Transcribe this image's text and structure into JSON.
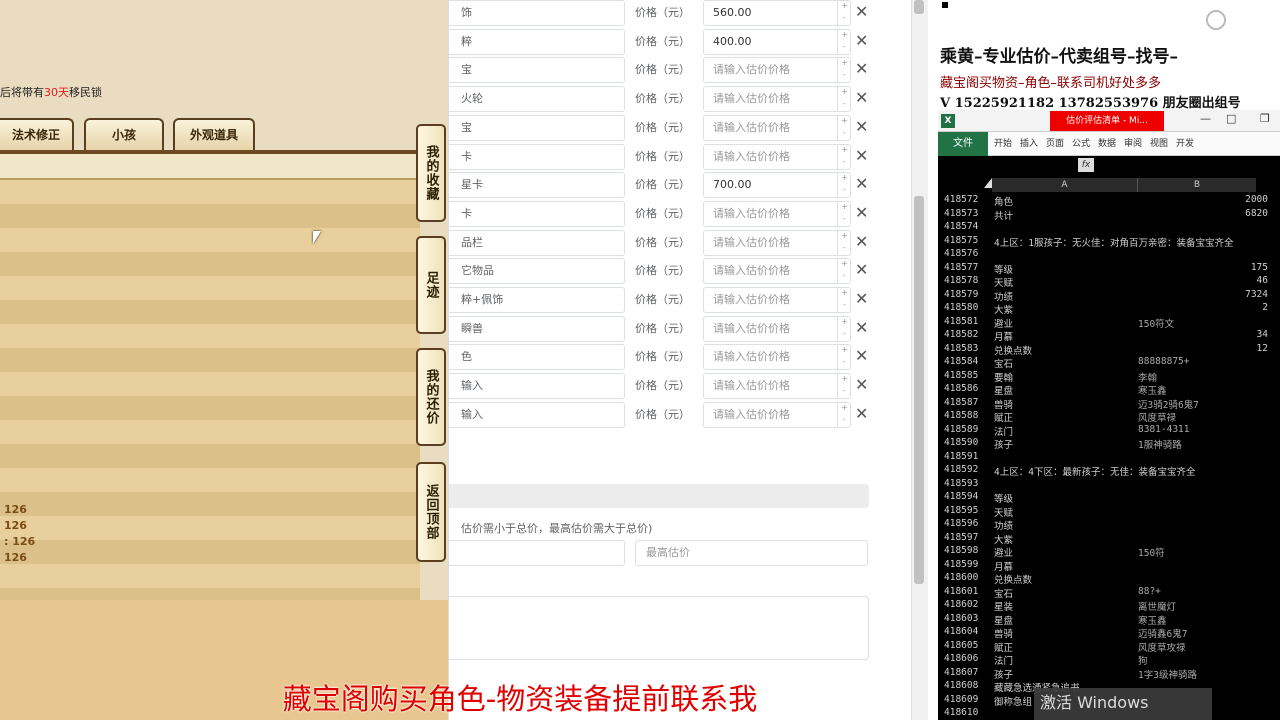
{
  "game": {
    "notice_prefix": "后将带有",
    "notice_days": "30天",
    "notice_suffix": "移民锁",
    "tabs": [
      "法术修正",
      "小孩",
      "外观道具"
    ],
    "side_buttons": [
      "我的收藏",
      "足迹",
      "我的还价",
      "返回顶部"
    ],
    "values": [
      "126",
      "126",
      ": 126",
      "126"
    ]
  },
  "form": {
    "price_label": "价格（元）",
    "price_placeholder": "请输入估价价格",
    "rows": [
      {
        "name": "饰",
        "price": "560.00"
      },
      {
        "name": "粹",
        "price": "400.00"
      },
      {
        "name": "宝",
        "price": ""
      },
      {
        "name": "火轮",
        "price": ""
      },
      {
        "name": "宝",
        "price": ""
      },
      {
        "name": "卡",
        "price": ""
      },
      {
        "name": "星卡",
        "price": "700.00"
      },
      {
        "name": "卡",
        "price": ""
      },
      {
        "name": "品栏",
        "price": ""
      },
      {
        "name": "它物品",
        "price": ""
      },
      {
        "name": "粹+佩饰",
        "price": ""
      },
      {
        "name": "瞬兽",
        "price": ""
      },
      {
        "name": "色",
        "price": ""
      },
      {
        "name": "输入",
        "price": ""
      },
      {
        "name": "输入",
        "price": ""
      }
    ],
    "hint": "估价需小于总价，最高估价需大于总价)",
    "max_placeholder": "最高估价"
  },
  "right": {
    "line1": "乘黄–专业估价–代卖组号–找号–",
    "line2": "藏宝阁买物资–角色–联系司机好处多多",
    "line3": "V 15225921182   13782553976 朋友圈出组号"
  },
  "excel": {
    "title": "估价评估清单 - Mi...",
    "file_tab": "文件",
    "ribbon_tabs": [
      "开始",
      "插入",
      "页面",
      "公式",
      "数据",
      "审阅",
      "视图",
      "开发"
    ],
    "col_a": "A",
    "col_b": "B",
    "fx": "fx",
    "rows": [
      {
        "n": "418572",
        "a": "角色",
        "b": "",
        "v": "2000"
      },
      {
        "n": "418573",
        "a": "共计",
        "b": "",
        "v": "6820"
      },
      {
        "n": "418574",
        "a": "",
        "b": "",
        "v": ""
      },
      {
        "n": "418575",
        "a": "4上区：1服孩子：无火佳：对角百万亲密：装备宝宝齐全",
        "b": "",
        "v": ""
      },
      {
        "n": "418576",
        "a": "",
        "b": "",
        "v": ""
      },
      {
        "n": "418577",
        "a": "等级",
        "b": "",
        "v": "175"
      },
      {
        "n": "418578",
        "a": "天赋",
        "b": "",
        "v": "46"
      },
      {
        "n": "418579",
        "a": "功绩",
        "b": "",
        "v": "7324"
      },
      {
        "n": "418580",
        "a": "大紫",
        "b": "",
        "v": "2"
      },
      {
        "n": "418581",
        "a": "避业",
        "b": "150符文",
        "v": ""
      },
      {
        "n": "418582",
        "a": "月慕",
        "b": "",
        "v": "34"
      },
      {
        "n": "418583",
        "a": "兑换点数",
        "b": "",
        "v": "12"
      },
      {
        "n": "418584",
        "a": "宝石",
        "b": "88888875+",
        "v": ""
      },
      {
        "n": "418585",
        "a": "要翰",
        "b": "李翰",
        "v": ""
      },
      {
        "n": "418586",
        "a": "星盘",
        "b": "寒玉鑫",
        "v": ""
      },
      {
        "n": "418587",
        "a": "兽骑",
        "b": "迈3骑2骑6鬼7",
        "v": ""
      },
      {
        "n": "418588",
        "a": "赋正",
        "b": "风度草禄",
        "v": ""
      },
      {
        "n": "418589",
        "a": "法门",
        "b": "8381-4311",
        "v": ""
      },
      {
        "n": "418590",
        "a": "孩子",
        "b": "1服神骑路",
        "v": ""
      },
      {
        "n": "418591",
        "a": "",
        "b": "",
        "v": ""
      },
      {
        "n": "418592",
        "a": "4上区：4下区：最新孩子：无佳：装备宝宝齐全",
        "b": "",
        "v": ""
      },
      {
        "n": "418593",
        "a": "",
        "b": "",
        "v": ""
      },
      {
        "n": "418594",
        "a": "等级",
        "b": "",
        "v": ""
      },
      {
        "n": "418595",
        "a": "天赋",
        "b": "",
        "v": ""
      },
      {
        "n": "418596",
        "a": "功绩",
        "b": "",
        "v": ""
      },
      {
        "n": "418597",
        "a": "大紫",
        "b": "",
        "v": ""
      },
      {
        "n": "418598",
        "a": "避业",
        "b": "150符",
        "v": ""
      },
      {
        "n": "418599",
        "a": "月慕",
        "b": "",
        "v": ""
      },
      {
        "n": "418600",
        "a": "兑换点数",
        "b": "",
        "v": ""
      },
      {
        "n": "418601",
        "a": "宝石",
        "b": "88?+",
        "v": ""
      },
      {
        "n": "418602",
        "a": "星装",
        "b": "离世魔灯",
        "v": ""
      },
      {
        "n": "418603",
        "a": "星盘",
        "b": "寒玉鑫",
        "v": ""
      },
      {
        "n": "418604",
        "a": "兽骑",
        "b": "迈骑鑫6鬼7",
        "v": ""
      },
      {
        "n": "418605",
        "a": "赋正",
        "b": "风度草攻禄",
        "v": ""
      },
      {
        "n": "418606",
        "a": "法门",
        "b": "狗",
        "v": ""
      },
      {
        "n": "418607",
        "a": "孩子",
        "b": "1字3级神骑路",
        "v": ""
      },
      {
        "n": "418608",
        "a": "藏藏急选通紧急追书",
        "b": "",
        "v": ""
      },
      {
        "n": "418609",
        "a": "御称急组",
        "b": "",
        "v": ""
      },
      {
        "n": "418610",
        "a": "",
        "b": "",
        "v": ""
      }
    ],
    "activate": "激活 Windows"
  },
  "caption": "藏宝阁购买角色-物资装备提前联系我"
}
